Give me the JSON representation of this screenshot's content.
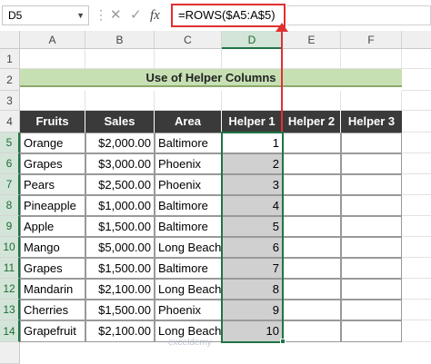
{
  "name_box": {
    "value": "D5"
  },
  "formula_bar": {
    "cancel_icon": "✕",
    "enter_icon": "✓",
    "fx_label": "fx",
    "formula": "=ROWS($A5:A$5)"
  },
  "columns": [
    "A",
    "B",
    "C",
    "D",
    "E",
    "F"
  ],
  "rows": [
    "1",
    "2",
    "3",
    "4",
    "5",
    "6",
    "7",
    "8",
    "9",
    "10",
    "11",
    "12",
    "13",
    "14"
  ],
  "sheet_title": "Use of Helper Columns",
  "table": {
    "headers": [
      "Fruits",
      "Sales",
      "Area",
      "Helper 1",
      "Helper 2",
      "Helper 3"
    ],
    "rows": [
      {
        "fruit": "Orange",
        "sales": "$2,000.00",
        "area": "Baltimore",
        "helper1": "1"
      },
      {
        "fruit": "Grapes",
        "sales": "$3,000.00",
        "area": "Phoenix",
        "helper1": "2"
      },
      {
        "fruit": "Pears",
        "sales": "$2,500.00",
        "area": "Phoenix",
        "helper1": "3"
      },
      {
        "fruit": "Pineapple",
        "sales": "$1,000.00",
        "area": "Baltimore",
        "helper1": "4"
      },
      {
        "fruit": "Apple",
        "sales": "$1,500.00",
        "area": "Baltimore",
        "helper1": "5"
      },
      {
        "fruit": "Mango",
        "sales": "$5,000.00",
        "area": "Long Beach",
        "helper1": "6"
      },
      {
        "fruit": "Grapes",
        "sales": "$1,500.00",
        "area": "Baltimore",
        "helper1": "7"
      },
      {
        "fruit": "Mandarin",
        "sales": "$2,100.00",
        "area": "Long Beach",
        "helper1": "8"
      },
      {
        "fruit": "Cherries",
        "sales": "$1,500.00",
        "area": "Phoenix",
        "helper1": "9"
      },
      {
        "fruit": "Grapefruit",
        "sales": "$2,100.00",
        "area": "Long Beach",
        "helper1": "10"
      }
    ]
  },
  "watermark": "exceldemy",
  "colors": {
    "accent": "#217346",
    "highlight": "#e03030",
    "title_fill": "#c6e0b4",
    "header_fill": "#3a3a3a"
  }
}
